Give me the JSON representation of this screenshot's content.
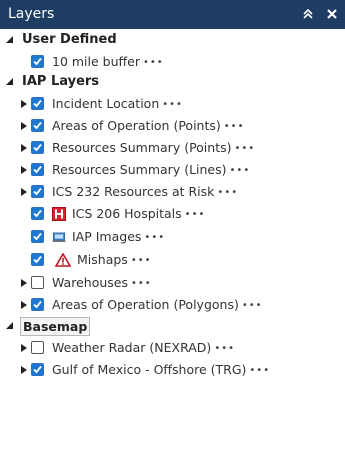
{
  "panel": {
    "title": "Layers"
  },
  "groups": {
    "user_defined": {
      "label": "User Defined",
      "items": [
        {
          "label": "10 mile buffer",
          "checked": true
        }
      ]
    },
    "iap": {
      "label": "IAP Layers",
      "items": [
        {
          "label": "Incident Location",
          "checked": true,
          "expandable": true
        },
        {
          "label": "Areas of Operation (Points)",
          "checked": true,
          "expandable": true
        },
        {
          "label": "Resources Summary (Points)",
          "checked": true,
          "expandable": true
        },
        {
          "label": "Resources Summary (Lines)",
          "checked": true,
          "expandable": true
        },
        {
          "label": "ICS 232 Resources at Risk",
          "checked": true,
          "expandable": true
        },
        {
          "label": "ICS 206 Hospitals",
          "checked": true,
          "icon": "hospital-icon"
        },
        {
          "label": "IAP Images",
          "checked": true,
          "icon": "image-icon"
        },
        {
          "label": "Mishaps",
          "checked": true,
          "icon": "warning-icon"
        },
        {
          "label": "Warehouses",
          "checked": false,
          "expandable": true
        },
        {
          "label": "Areas of Operation (Polygons)",
          "checked": true,
          "expandable": true
        }
      ]
    },
    "basemap": {
      "label": "Basemap",
      "items": [
        {
          "label": "Weather Radar (NEXRAD)",
          "checked": false,
          "expandable": true
        },
        {
          "label": "Gulf of Mexico - Offshore (TRG)",
          "checked": true,
          "expandable": true
        }
      ]
    }
  },
  "menu_glyph": "•••",
  "colors": {
    "header": "#1d3d63",
    "checkbox": "#1e78d2"
  }
}
